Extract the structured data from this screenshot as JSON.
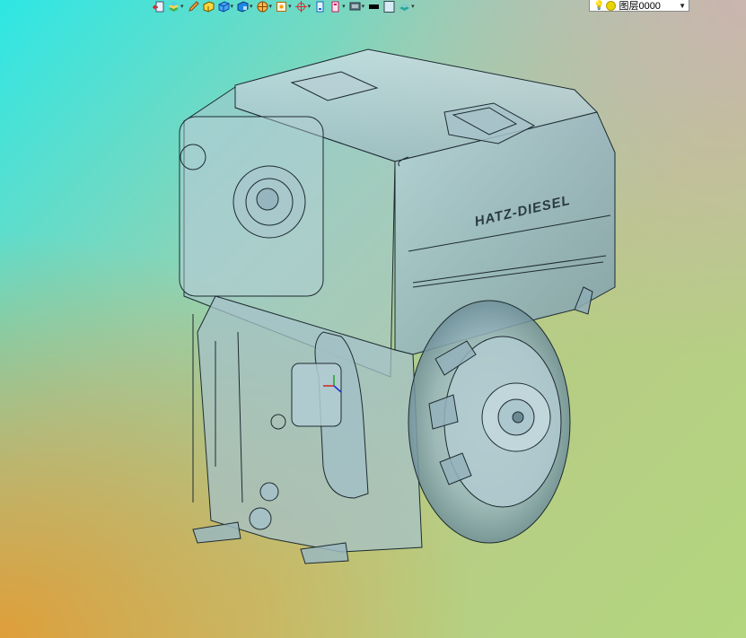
{
  "toolbar": {
    "buttons": [
      {
        "icon": "exit-icon"
      },
      {
        "icon": "layer-stack-icon"
      },
      {
        "icon": "pencil-icon"
      },
      {
        "icon": "box-yellow-icon"
      },
      {
        "icon": "cube-blue-icon"
      },
      {
        "icon": "cube-shade-icon"
      },
      {
        "icon": "sphere-section-icon"
      },
      {
        "icon": "frame-icon"
      },
      {
        "icon": "crosshair-icon"
      },
      {
        "icon": "page-icon"
      },
      {
        "icon": "page-dropdown-icon"
      },
      {
        "icon": "monitor-icon"
      },
      {
        "icon": "color-swatch-black"
      },
      {
        "icon": "color-swatch-light"
      },
      {
        "icon": "layer-green-icon"
      }
    ],
    "layer": {
      "value": "图层0000"
    }
  },
  "model": {
    "brand_text": "HATZ-DIESEL"
  },
  "colors": {
    "engine_body": "#9fbcc4",
    "engine_dark": "#7fa0aa",
    "wire": "#1d2b30"
  }
}
